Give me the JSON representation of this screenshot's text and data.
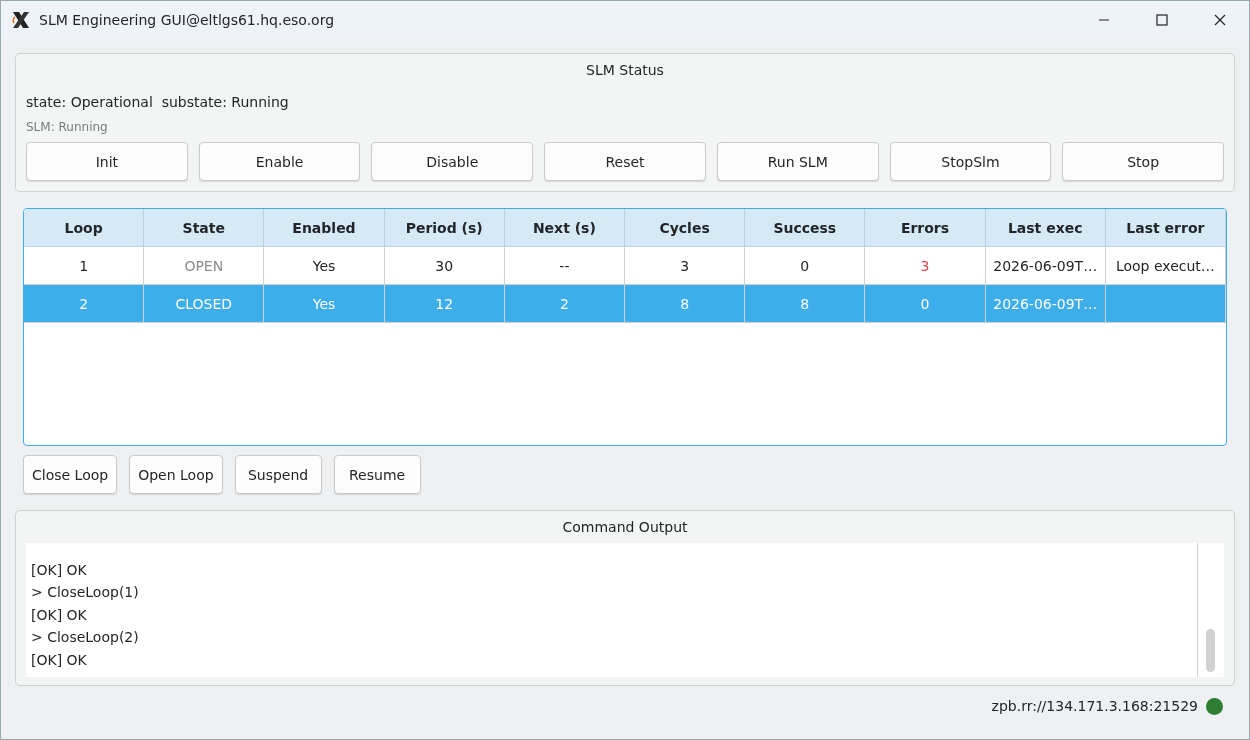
{
  "window": {
    "title": "SLM Engineering GUI@eltlgs61.hq.eso.org"
  },
  "slm_status": {
    "title": "SLM Status",
    "state_line": "state: Operational  substate: Running",
    "slm_line": "SLM: Running",
    "buttons": [
      "Init",
      "Enable",
      "Disable",
      "Reset",
      "Run SLM",
      "StopSlm",
      "Stop"
    ]
  },
  "table": {
    "columns": [
      "Loop",
      "State",
      "Enabled",
      "Period (s)",
      "Next (s)",
      "Cycles",
      "Success",
      "Errors",
      "Last exec",
      "Last error"
    ],
    "rows": [
      {
        "selected": false,
        "state_muted": true,
        "errors_alert": true,
        "cells": [
          "1",
          "OPEN",
          "Yes",
          "30",
          "--",
          "3",
          "0",
          "3",
          "2026-06-09T…",
          "Loop execut…"
        ]
      },
      {
        "selected": true,
        "state_muted": false,
        "errors_alert": false,
        "cells": [
          "2",
          "CLOSED",
          "Yes",
          "12",
          "2",
          "8",
          "8",
          "0",
          "2026-06-09T…",
          ""
        ]
      }
    ]
  },
  "loop_buttons": [
    "Close Loop",
    "Open Loop",
    "Suspend",
    "Resume"
  ],
  "command_output": {
    "title": "Command Output",
    "lines": [
      "[OK] OK",
      "> CloseLoop(1)",
      "[OK] OK",
      "> CloseLoop(2)",
      "[OK] OK"
    ]
  },
  "status_bar": {
    "address": "zpb.rr://134.171.3.168:21529",
    "connected": true
  }
}
